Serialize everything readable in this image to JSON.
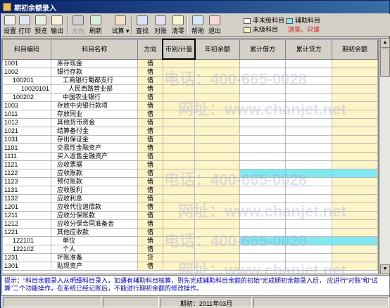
{
  "window": {
    "title": "期初余额录入"
  },
  "toolbar": [
    {
      "name": "settings-button",
      "icon": "settings-icon",
      "label": "设置",
      "disabled": false
    },
    {
      "name": "print-button",
      "icon": "printer-icon",
      "label": "打印",
      "disabled": false
    },
    {
      "name": "preview-button",
      "icon": "preview-icon",
      "label": "预览",
      "disabled": false
    },
    {
      "name": "export-button",
      "icon": "export-icon",
      "label": "输出",
      "disabled": false
    },
    {
      "name": "direction-button",
      "icon": "direction-icon",
      "label": "方向",
      "disabled": true
    },
    {
      "name": "refresh-button",
      "icon": "refresh-icon",
      "label": "刷新",
      "disabled": false
    },
    {
      "name": "trial-balance-button",
      "icon": "scale-icon",
      "label": "试算",
      "disabled": false
    },
    {
      "name": "find-button",
      "icon": "search-icon",
      "label": "查找",
      "disabled": false
    },
    {
      "name": "reconcile-button",
      "icon": "reconcile-icon",
      "label": "对账",
      "disabled": false
    },
    {
      "name": "clear-button",
      "icon": "clear-icon",
      "label": "清零",
      "disabled": false
    },
    {
      "name": "help-button",
      "icon": "help-icon",
      "label": "帮助",
      "disabled": false
    },
    {
      "name": "exit-button",
      "icon": "exit-icon",
      "label": "退出",
      "disabled": false
    }
  ],
  "legend": {
    "non_leaf": "非末级科目",
    "leaf": "末级科目",
    "aux": "辅助科目",
    "readonly_note": "浏览、只读",
    "colors": {
      "non_leaf": "#ffffff",
      "leaf": "#fdf5c8",
      "aux": "#80e8f0",
      "readonly_note": "#e00000"
    }
  },
  "columns": [
    "科目编码",
    "科目名称",
    "方向",
    "币别/计量",
    "年初余额",
    "累计借方",
    "累计贷方",
    "期初余额"
  ],
  "rows": [
    {
      "code": "1001",
      "name": "库存现金",
      "dir": "借",
      "indent": 0,
      "aux": false
    },
    {
      "code": "1002",
      "name": "银行存款",
      "dir": "借",
      "indent": 0,
      "aux": false
    },
    {
      "code": "100201",
      "name": "工商银行蜀都支行",
      "dir": "借",
      "indent": 1,
      "aux": false
    },
    {
      "code": "10020101",
      "name": "人民西路营业部",
      "dir": "借",
      "indent": 2,
      "aux": false
    },
    {
      "code": "100202",
      "name": "中国农业银行",
      "dir": "借",
      "indent": 1,
      "aux": false
    },
    {
      "code": "1003",
      "name": "存放中央银行款项",
      "dir": "借",
      "indent": 0,
      "aux": false
    },
    {
      "code": "1011",
      "name": "存放同业",
      "dir": "借",
      "indent": 0,
      "aux": false
    },
    {
      "code": "1012",
      "name": "其他货币资金",
      "dir": "借",
      "indent": 0,
      "aux": false
    },
    {
      "code": "1021",
      "name": "结算备付金",
      "dir": "借",
      "indent": 0,
      "aux": false
    },
    {
      "code": "1031",
      "name": "存出保证金",
      "dir": "借",
      "indent": 0,
      "aux": false
    },
    {
      "code": "1101",
      "name": "交易性金融资产",
      "dir": "借",
      "indent": 0,
      "aux": false
    },
    {
      "code": "1111",
      "name": "买入返售金融资产",
      "dir": "借",
      "indent": 0,
      "aux": false
    },
    {
      "code": "1121",
      "name": "应收票据",
      "dir": "借",
      "indent": 0,
      "aux": false
    },
    {
      "code": "1122",
      "name": "应收账款",
      "dir": "借",
      "indent": 0,
      "aux": true
    },
    {
      "code": "1123",
      "name": "预付账款",
      "dir": "借",
      "indent": 0,
      "aux": false
    },
    {
      "code": "1131",
      "name": "应收股利",
      "dir": "借",
      "indent": 0,
      "aux": false
    },
    {
      "code": "1132",
      "name": "应收利息",
      "dir": "借",
      "indent": 0,
      "aux": false
    },
    {
      "code": "1201",
      "name": "应收代位追偿款",
      "dir": "借",
      "indent": 0,
      "aux": false
    },
    {
      "code": "1211",
      "name": "应收分保账款",
      "dir": "借",
      "indent": 0,
      "aux": false
    },
    {
      "code": "1212",
      "name": "应收分保合同准备金",
      "dir": "借",
      "indent": 0,
      "aux": false
    },
    {
      "code": "1221",
      "name": "其他应收款",
      "dir": "借",
      "indent": 0,
      "aux": false
    },
    {
      "code": "122101",
      "name": "单位",
      "dir": "借",
      "indent": 1,
      "aux": true
    },
    {
      "code": "122102",
      "name": "个人",
      "dir": "借",
      "indent": 1,
      "aux": false
    },
    {
      "code": "1231",
      "name": "坏账准备",
      "dir": "贷",
      "indent": 0,
      "aux": false
    },
    {
      "code": "1301",
      "name": "贴现资产",
      "dir": "借",
      "indent": 0,
      "aux": false
    }
  ],
  "hint": "提示：“科目余额录入从明细科目录入，如遇有辅助科目核算，则先完成辅助科目余额的初始”完成期初余额录入后，        应进行“对账”和“试算”二个功能操作，在系统已经记账后，不能进行期初余额的修改操作。",
  "status": {
    "period_label": "期初：2011年03月"
  },
  "watermarks": [
    "电话：400-665-0028",
    "网址：www.chanjet.net"
  ]
}
